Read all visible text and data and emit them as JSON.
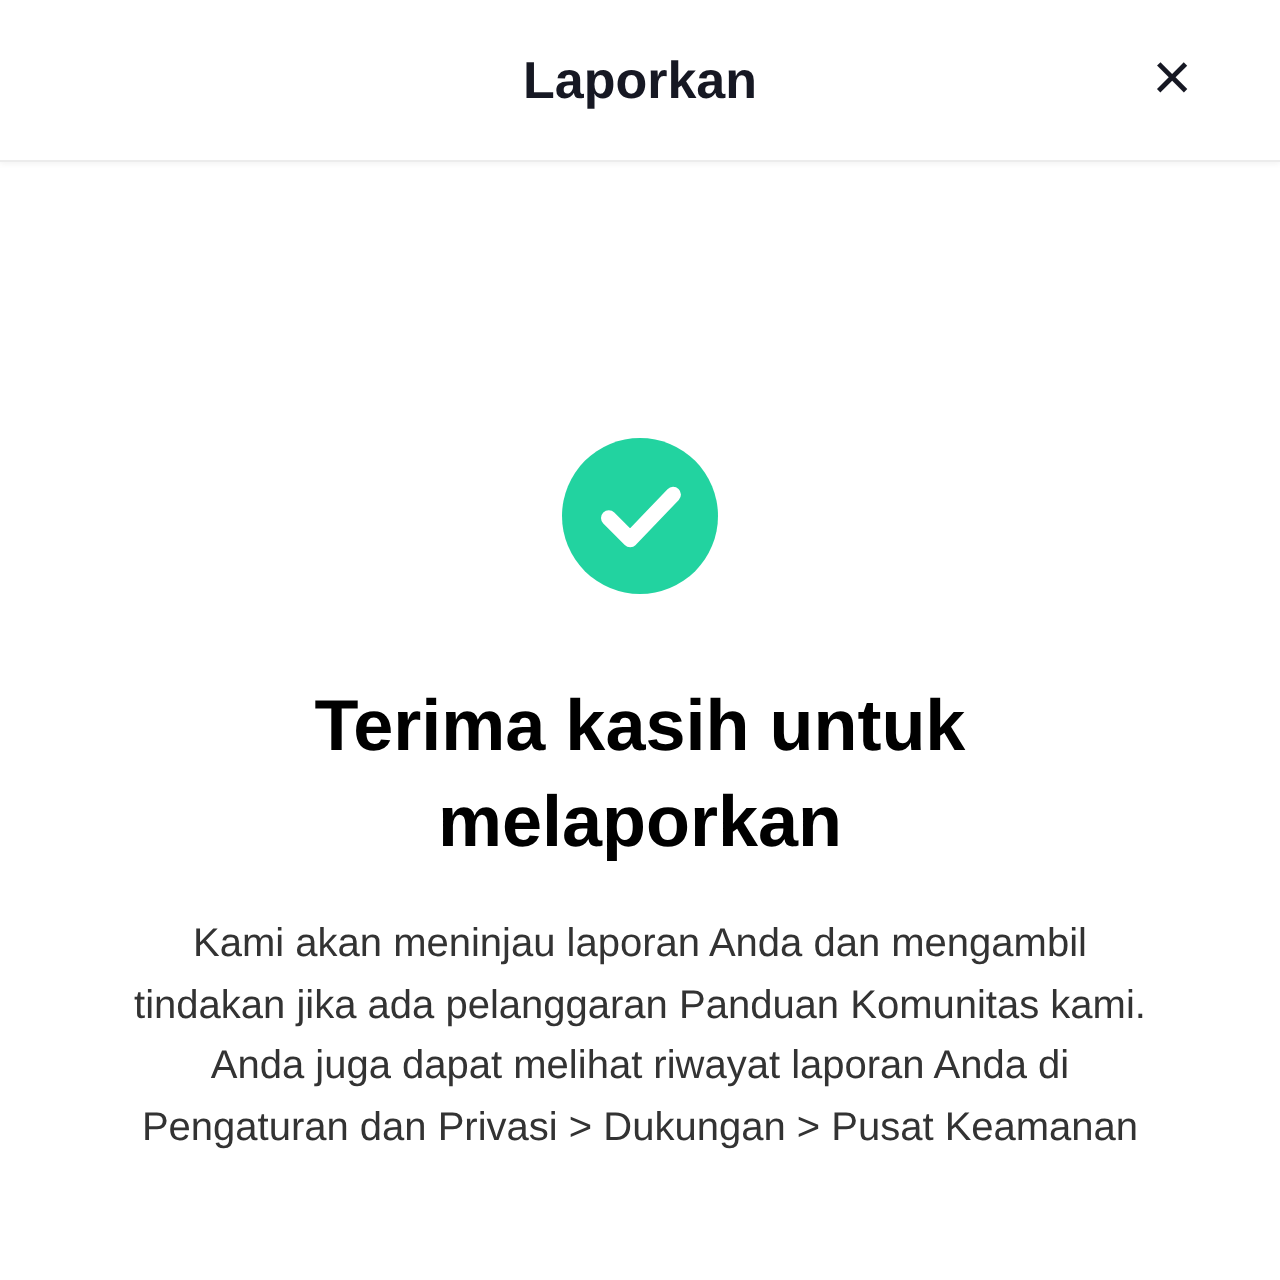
{
  "header": {
    "title": "Laporkan",
    "close": "×"
  },
  "message": {
    "title": "Terima kasih untuk melaporkan",
    "body": "Kami akan meninjau laporan Anda dan mengambil tindakan jika ada pelanggaran Panduan Komunitas kami. Anda juga dapat melihat riwayat laporan Anda di Pengaturan dan Privasi > Dukungan > Pusat Keamanan"
  }
}
